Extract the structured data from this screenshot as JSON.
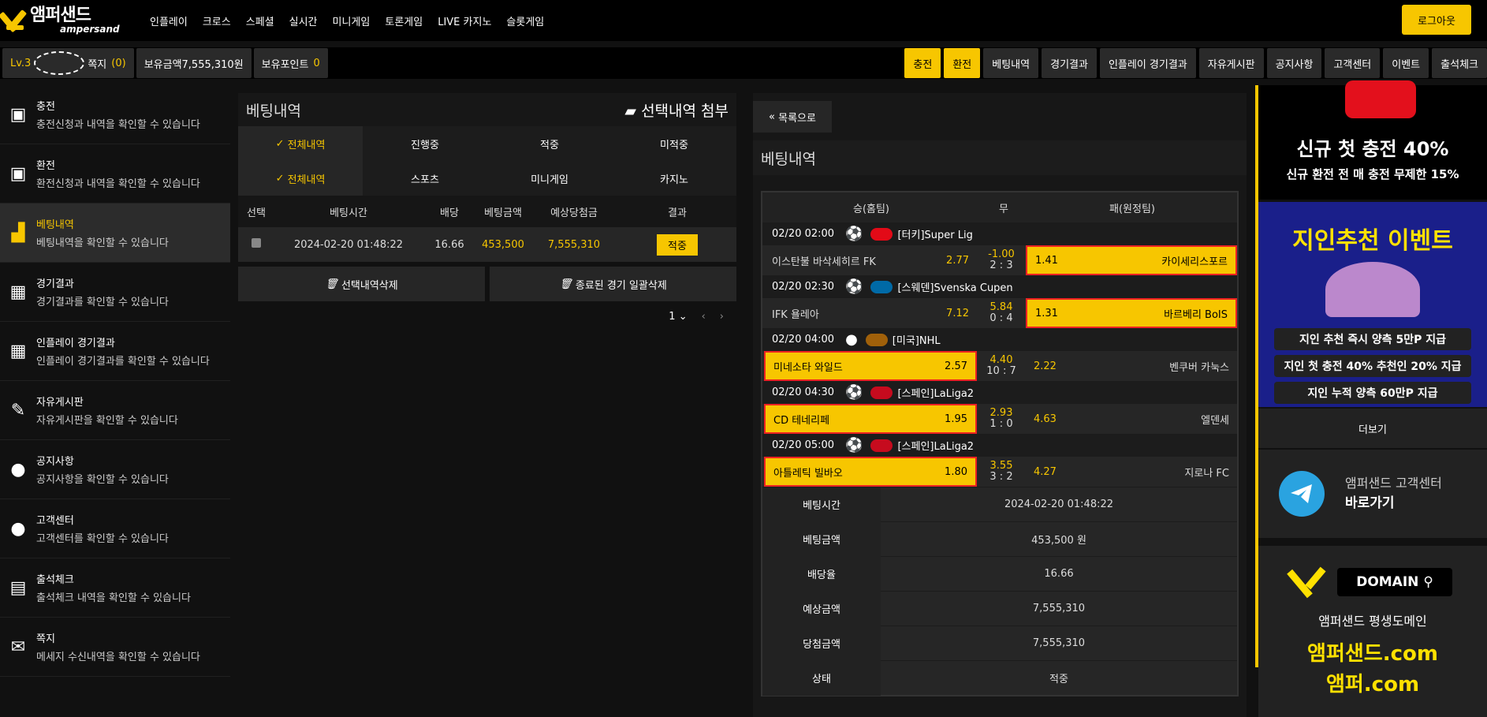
{
  "brand": {
    "name": "앰퍼샌드",
    "sub": "ampersand"
  },
  "mainmenu": [
    "인플레이",
    "크로스",
    "스페셜",
    "실시간",
    "미니게임",
    "토론게임",
    "LIVE 카지노",
    "슬롯게임"
  ],
  "logout": "로그아웃",
  "user": {
    "level": "Lv.3",
    "memo_label": "쪽지",
    "memo_count": "(0)",
    "balance_label": "보유금액",
    "balance": "7,555,310원",
    "point_label": "보유포인트",
    "point": "0"
  },
  "rightmenu": [
    "충전",
    "환전",
    "베팅내역",
    "경기결과",
    "인플레이 경기결과",
    "자유게시판",
    "공지사항",
    "고객센터",
    "이벤트",
    "출석체크"
  ],
  "sidebar": [
    {
      "title": "충전",
      "desc": "충전신청과 내역을 확인할 수 있습니다"
    },
    {
      "title": "환전",
      "desc": "환전신청과 내역을 확인할 수 있습니다"
    },
    {
      "title": "베팅내역",
      "desc": "베팅내역을 확인할 수 있습니다"
    },
    {
      "title": "경기결과",
      "desc": "경기결과를 확인할 수 있습니다"
    },
    {
      "title": "인플레이 경기결과",
      "desc": "인플레이 경기결과를 확인할 수 있습니다"
    },
    {
      "title": "자유게시판",
      "desc": "자유게시판을 확인할 수 있습니다"
    },
    {
      "title": "공지사항",
      "desc": "공지사항을 확인할 수 있습니다"
    },
    {
      "title": "고객센터",
      "desc": "고객센터를 확인할 수 있습니다"
    },
    {
      "title": "출석체크",
      "desc": "출석체크 내역을 확인할 수 있습니다"
    },
    {
      "title": "쪽지",
      "desc": "메세지 수신내역을 확인할 수 있습니다"
    }
  ],
  "bets": {
    "title": "베팅내역",
    "attach": "선택내역 첨부",
    "tabs1": [
      "전체내역",
      "진행중",
      "적중",
      "미적중"
    ],
    "tabs2": [
      "전체내역",
      "스포츠",
      "미니게임",
      "카지노"
    ],
    "headers": [
      "선택",
      "베팅시간",
      "배당",
      "베팅금액",
      "예상당첨금",
      "결과"
    ],
    "row": {
      "time": "2024-02-20 01:48:22",
      "odds": "16.66",
      "amount": "453,500",
      "expected": "7,555,310",
      "result": "적중"
    },
    "del_selected": "선택내역삭제",
    "del_finished": "종료된 경기 일괄삭제",
    "page": "1"
  },
  "detail": {
    "back": "목록으로",
    "title": "베팅내역",
    "headers": [
      "승(홈팀)",
      "무",
      "패(원정팀)"
    ],
    "matches": [
      {
        "time": "02/20 02:00",
        "ball": "⚽",
        "league": "[터키]Super Lig",
        "flag": "#e30a17",
        "home": "이스탄불 바삭세히르 FK",
        "home_odds": "2.77",
        "draw": "-1.00",
        "score": "2 : 3",
        "away": "카이세리스포르",
        "away_odds": "1.41"
      },
      {
        "time": "02/20 02:30",
        "ball": "⚽",
        "league": "[스웨덴]Svenska Cupen",
        "flag": "#006aa7",
        "home": "IFK 욜레아",
        "home_odds": "7.12",
        "draw": "5.84",
        "score": "0 : 4",
        "away": "바르베리 BoIS",
        "away_odds": "1.31"
      },
      {
        "time": "02/20 04:00",
        "ball": "●",
        "league": "[미국]NHL",
        "flag": "#a0600a",
        "home": "미네소타 와일드",
        "home_odds": "2.57",
        "draw": "4.40",
        "score": "10 : 7",
        "away": "벤쿠버 카눅스",
        "away_odds": "2.22"
      },
      {
        "time": "02/20 04:30",
        "ball": "⚽",
        "league": "[스페인]LaLiga2",
        "flag": "#c60b1e",
        "home": "CD 테네리페",
        "home_odds": "1.95",
        "draw": "2.93",
        "score": "1 : 0",
        "away": "엘덴세",
        "away_odds": "4.63"
      },
      {
        "time": "02/20 05:00",
        "ball": "⚽",
        "league": "[스페인]LaLiga2",
        "flag": "#c60b1e",
        "home": "아틀레틱 빌바오",
        "home_odds": "1.80",
        "draw": "3.55",
        "score": "3 : 2",
        "away": "지로나 FC",
        "away_odds": "4.27"
      }
    ],
    "info": [
      {
        "k": "베팅시간",
        "v": "2024-02-20 01:48:22"
      },
      {
        "k": "베팅금액",
        "v": "453,500 원"
      },
      {
        "k": "배당율",
        "v": "16.66"
      },
      {
        "k": "예상금액",
        "v": "7,555,310"
      },
      {
        "k": "당첨금액",
        "v": "7,555,310"
      },
      {
        "k": "상태",
        "v": "적중"
      }
    ]
  },
  "ads": {
    "a1": "신규 첫 충전 40%",
    "a1b": "신규 환전 전 매 충전 무제한 15%",
    "a2": "지인추천 이벤트",
    "a2p": [
      "지인 추천 즉시 양측 5만P 지급",
      "지인 첫 충전 40% 추천인 20% 지급",
      "지인 누적 양측 60만P 지급"
    ],
    "more": "더보기",
    "tg1": "앰퍼샌드 고객센터",
    "tg2": "바로가기",
    "domain": "DOMAIN",
    "d2": "앰퍼샌드 평생도메인",
    "d3": "앰퍼샌드.com",
    "d4": "앰퍼.com"
  }
}
